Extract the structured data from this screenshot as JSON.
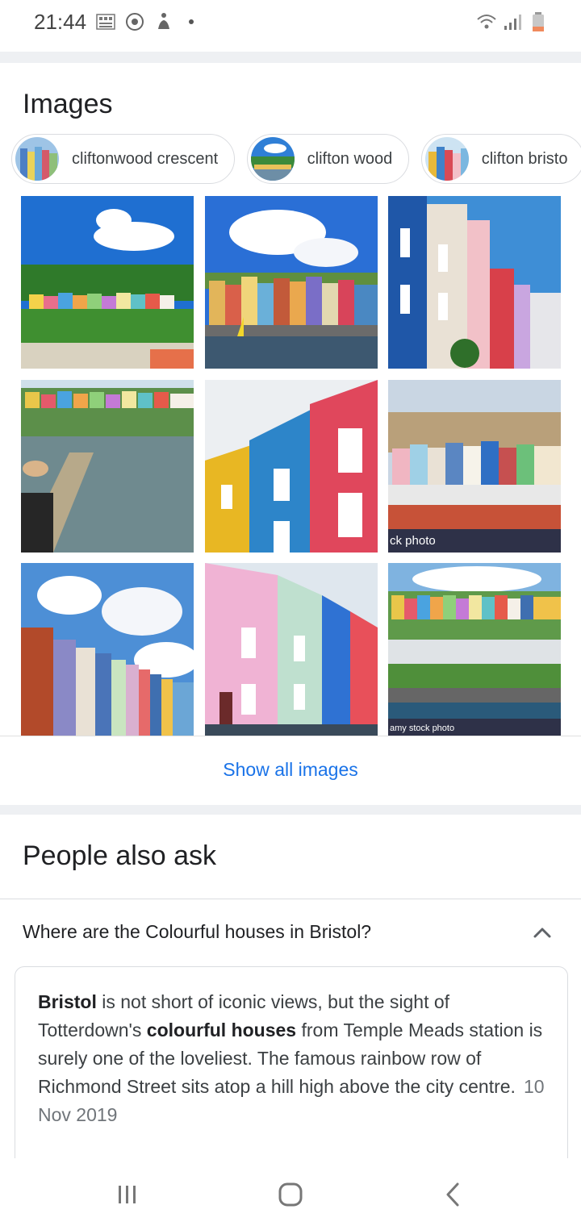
{
  "status_bar": {
    "time": "21:44",
    "left_icons": [
      "qr-code-icon",
      "screen-recorder-icon",
      "accessibility-icon",
      "notification-dot-icon"
    ],
    "right_icons": [
      "wifi-icon",
      "cell-signal-icon",
      "battery-low-icon"
    ]
  },
  "images": {
    "title": "Images",
    "chips": [
      {
        "label": "cliftonwood crescent",
        "thumb": "rainbow-houses-thumb"
      },
      {
        "label": "clifton wood",
        "thumb": "hillside-houses-thumb"
      },
      {
        "label": "clifton bristo",
        "thumb": "colourful-terrace-thumb"
      }
    ],
    "grid": [
      {
        "subject": "hillside houses under blue sky"
      },
      {
        "subject": "harbourside colourful houses"
      },
      {
        "subject": "blue and pink terraced houses"
      },
      {
        "subject": "harbour walkway with woman in hat"
      },
      {
        "subject": "yellow blue red houses close-up"
      },
      {
        "subject": "hillside houses stock photo",
        "caption": "ck photo"
      },
      {
        "subject": "street terrace under cloudy sky"
      },
      {
        "subject": "pink mint blue red terrace"
      },
      {
        "subject": "rainbow houses over river stock photo",
        "caption": "amy stock photo"
      }
    ],
    "show_all_label": "Show all images"
  },
  "people_also_ask": {
    "title": "People also ask",
    "question": "Where are the Colourful houses in Bristol?",
    "answer": {
      "bold1": "Bristol",
      "text1": " is not short of iconic views, but the sight of Totterdown's ",
      "bold2": "colourful houses",
      "text2": " from Temple Meads station is surely one of the loveliest. The famous rainbow row of Richmond Street sits atop a hill high above the city centre.",
      "date": "10 Nov 2019"
    }
  },
  "nav_bar": {
    "buttons": [
      "recent-apps-icon",
      "home-icon",
      "back-icon"
    ]
  },
  "colors": {
    "link_blue": "#1a73e8",
    "divider": "#dadce0",
    "band": "#eef0f3"
  }
}
